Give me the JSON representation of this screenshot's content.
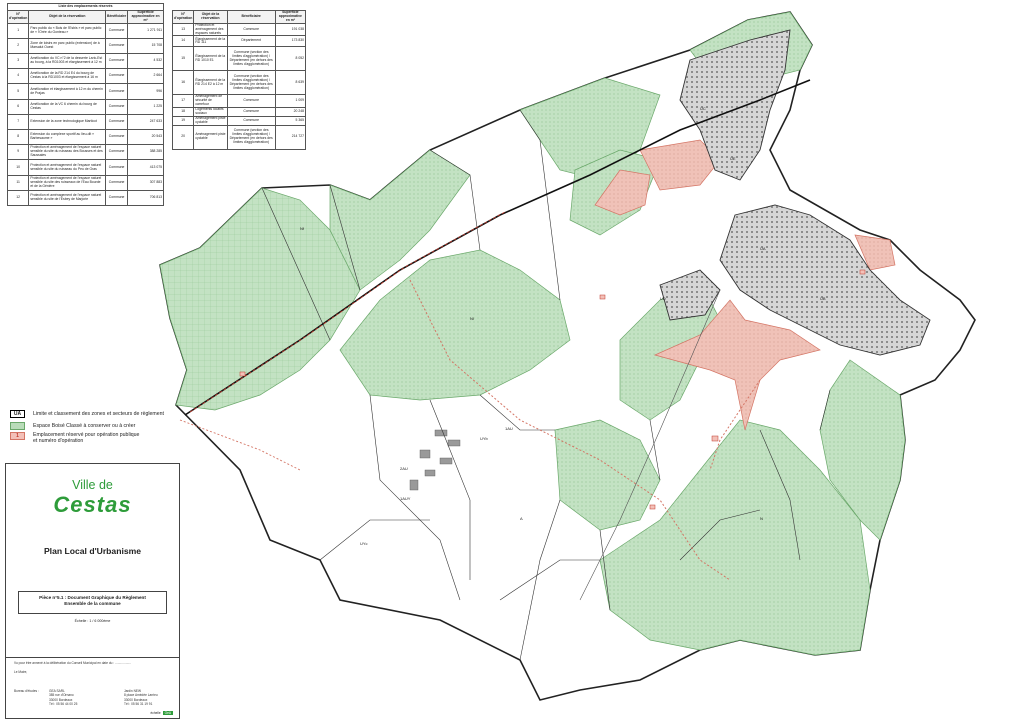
{
  "table1": {
    "caption": "Liste des emplacements réservés",
    "headers": [
      "N° d'opération",
      "Objet de la réservation",
      "Bénéficiaire",
      "Superficie approximative en m²"
    ],
    "rows": [
      [
        "1",
        "Parc public du « Bois de l'Esbis » et parc public de « l'Orée du Gonteau »",
        "Commune",
        "1 271 911"
      ],
      [
        "2",
        "Zone de loisirs en parc public (extension) de à Marsalut Ouest",
        "Commune",
        "15 708"
      ],
      [
        "3",
        "Amélioration du VC n°2 de la desserte Laric-Est au bourg, à la RD1003 et élargissement à 12 m",
        "Commune",
        "4 532"
      ],
      [
        "4",
        "Amélioration de la RD 214 E4 du bourg de Cestas à la RD1003 et élargissement à 16 m",
        "Commune",
        "2 664"
      ],
      [
        "5",
        "Amélioration et élargissement à 12 m du chemin de Prajas",
        "Commune",
        "996"
      ],
      [
        "6",
        "Amélioration de la VC 6 chemin du bourg de Cestas",
        "Commune",
        "1 225"
      ],
      [
        "7",
        "Extension de la zone technologique Marticot",
        "Commune",
        "247 633"
      ],
      [
        "8",
        "Extension du complexe sportif au lieu-dit « Barbesaume »",
        "Commune",
        "20 543"
      ],
      [
        "9",
        "Protection et aménagement de l'espace naturel sensible du site du ruisseau des Bousses et des Saussaies",
        "Commune",
        "388 285"
      ],
      [
        "10",
        "Protection et aménagement de l'espace naturel sensible du site du ruisseau du Peu de Gras",
        "Commune",
        "413 075"
      ],
      [
        "11",
        "Protection et aménagement de l'espace naturel sensible du site des ruisseaux de l'Eau Bourde et de la Génière",
        "Commune",
        "307 883"
      ],
      [
        "12",
        "Protection et aménagement de l'espace naturel sensible du site de l'Esbey de Marjorie",
        "Commune",
        "706 813"
      ]
    ]
  },
  "table2": {
    "headers": [
      "N° d'opération",
      "Objet de la réservation",
      "Bénéficiaire",
      "Superficie approximative en m²"
    ],
    "rows": [
      [
        "13",
        "Protection et aménagement des espaces naturels",
        "Commune",
        "191 038"
      ],
      [
        "14",
        "Élargissement de la RD 111",
        "Département",
        "173 830"
      ],
      [
        "15",
        "Élargissement de la RD 1010 E1",
        "Commune (section des limites d'agglomération) / Département (en dehors des limites d'agglomération)",
        "8 052"
      ],
      [
        "16",
        "Élargissement de la RD 214 E2 à 12 m",
        "Commune (section des limites d'agglomération) / Département (en dehors des limites d'agglomération)",
        "8 639"
      ],
      [
        "17",
        "Aménagement de sécurité de carrefour",
        "Commune",
        "1 009"
      ],
      [
        "18",
        "Logements locatifs sociaux",
        "Commune",
        "20 248"
      ],
      [
        "19",
        "Aménagement piste cyclable",
        "Commune",
        "5 365"
      ],
      [
        "20",
        "Aménagement piste cyclable",
        "Commune (section des limites d'agglomération) / Département (en dehors des limites d'agglomération)",
        "214 727"
      ]
    ]
  },
  "legend": {
    "ua_symbol": "UA",
    "ua_label": "Limite et classement des zones et secteurs de règlement",
    "ebc_label": "Espace Boisé Classé à conserver ou à créer",
    "er_symbol": "1",
    "er_label_1": "Emplacement réservé pour opération publique",
    "er_label_2": "et numéro d'opération"
  },
  "cartouche": {
    "ville": "Ville de",
    "cestas": "Cestas",
    "title": "Plan Local d'Urbanisme",
    "piece_line1": "Pièce n°5.1 : Document Graphique du Règlement",
    "piece_line2": "Ensemble de la commune",
    "scale": "Échelle : 1 / 6 000ème",
    "note1": "Vu pour être annexé à la délibération du Conseil Municipal en date du : ..................",
    "note2": "Le Maire,",
    "bureau_label": "Bureau d'études :",
    "bureau_addr": [
      "GEA SARL",
      "385 rue d'Ornano",
      "33000 Bordeaux",
      "Tél : 05 56 44 00 25"
    ],
    "jardin_addr": [
      "Jardin NEW",
      "8 place Amédée Larrieu",
      "33000 Bordeaux",
      "Tél : 05 56 31 19 91"
    ],
    "echelle_tag": "échelle",
    "logo_text": "GeA"
  },
  "map_labels": [
    "UA",
    "UB",
    "UC",
    "UD",
    "UE",
    "1AU",
    "2AU",
    "A",
    "N",
    "Nf",
    "Nl",
    "UYb",
    "1AUY",
    "UYc"
  ],
  "colors": {
    "ebc_fill": "#b9dcb9",
    "ebc_stroke": "#6aa86a",
    "reserve_fill": "#f3c0b8",
    "reserve_stroke": "#d47565",
    "zone_line": "#333333",
    "urban": "#9a9a9a",
    "brand_green": "#2e9c3a"
  }
}
